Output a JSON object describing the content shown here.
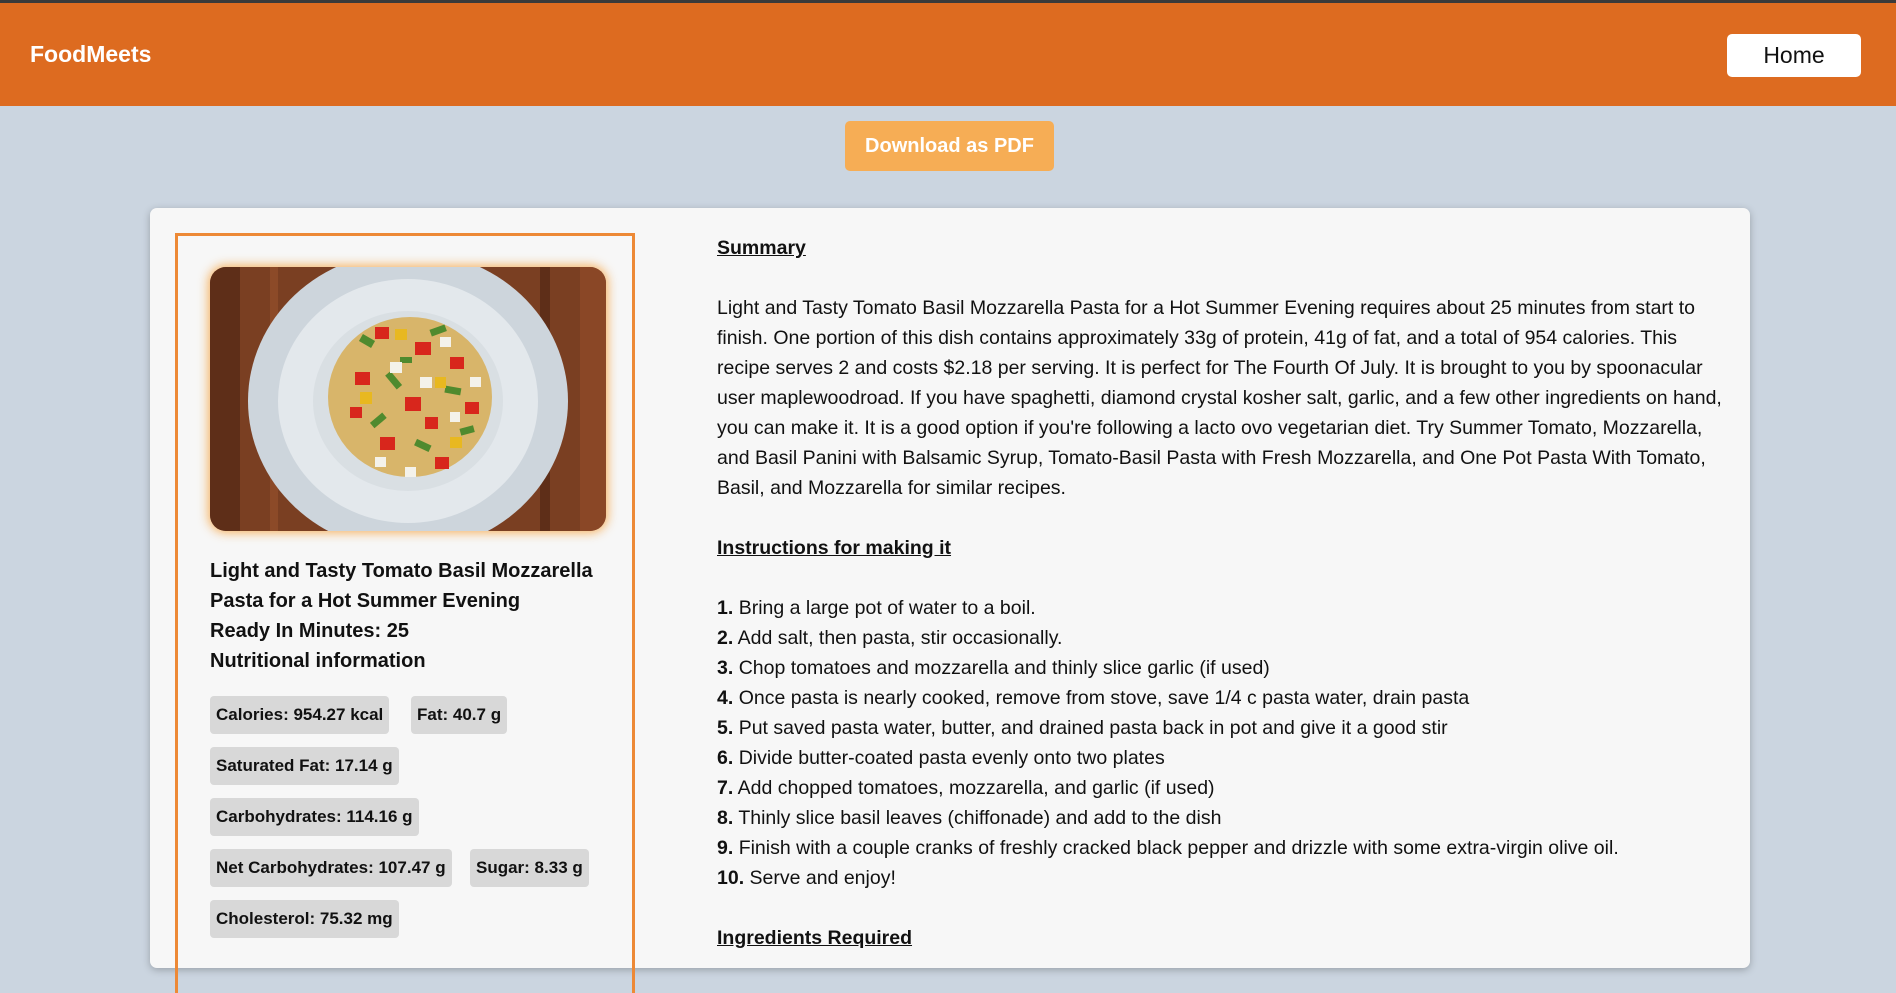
{
  "navbar": {
    "brand": "FoodMeets",
    "home_label": "Home",
    "color": "#dd6b20"
  },
  "actions": {
    "download_label": "Download as PDF"
  },
  "recipe": {
    "image_alt": "Tomato basil mozzarella pasta on a white plate",
    "title": "Light and Tasty Tomato Basil Mozzarella Pasta for a Hot Summer Evening",
    "ready": "Ready In Minutes: 25",
    "nutrition_heading": "Nutritional information",
    "nutrition": [
      "Calories: 954.27 kcal",
      "Fat: 40.7 g",
      "Saturated Fat: 17.14 g",
      "Carbohydrates: 114.16 g",
      "Net Carbohydrates: 107.47 g",
      "Sugar: 8.33 g",
      "Cholesterol: 75.32 mg"
    ]
  },
  "summary": {
    "heading": "Summary",
    "text": "Light and Tasty Tomato Basil Mozzarella Pasta for a Hot Summer Evening requires about 25 minutes from start to finish. One portion of this dish contains approximately 33g of protein, 41g of fat, and a total of 954 calories. This recipe serves 2 and costs $2.18 per serving. It is perfect for The Fourth Of July. It is brought to you by spoonacular user maplewoodroad. If you have spaghetti, diamond crystal kosher salt, garlic, and a few other ingredients on hand, you can make it. It is a good option if you're following a lacto ovo vegetarian diet. Try Summer Tomato, Mozzarella, and Basil Panini with Balsamic Syrup, Tomato-Basil Pasta with Fresh Mozzarella, and One Pot Pasta With Tomato, Basil, and Mozzarella for similar recipes."
  },
  "instructions": {
    "heading": "Instructions for making it",
    "steps": [
      {
        "num": "1.",
        "text": "Bring a large pot of water to a boil."
      },
      {
        "num": "2.",
        "text": "Add salt, then pasta, stir occasionally."
      },
      {
        "num": "3.",
        "text": "Chop tomatoes and mozzarella and thinly slice garlic (if used)"
      },
      {
        "num": "4.",
        "text": "Once pasta is nearly cooked, remove from stove, save 1/4 c pasta water, drain pasta"
      },
      {
        "num": "5.",
        "text": "Put saved pasta water, butter, and drained pasta back in pot and give it a good stir"
      },
      {
        "num": "6.",
        "text": "Divide butter-coated pasta evenly onto two plates"
      },
      {
        "num": "7.",
        "text": "Add chopped tomatoes, mozzarella, and garlic (if used)"
      },
      {
        "num": "8.",
        "text": "Thinly slice basil leaves (chiffonade) and add to the dish"
      },
      {
        "num": "9.",
        "text": "Finish with a couple cranks of freshly cracked black pepper and drizzle with some extra-virgin olive oil."
      },
      {
        "num": "10.",
        "text": "Serve and enjoy!"
      }
    ]
  },
  "ingredients": {
    "heading": "Ingredients Required"
  }
}
